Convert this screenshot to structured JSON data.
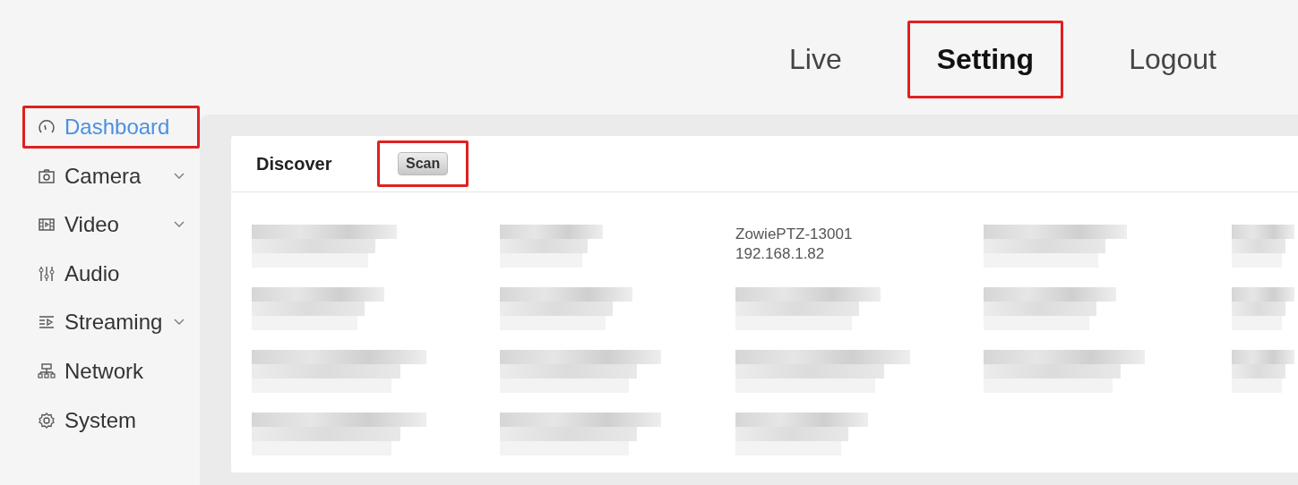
{
  "top_nav": [
    {
      "label": "Live",
      "selected": false,
      "annotated": false
    },
    {
      "label": "Setting",
      "selected": true,
      "annotated": true
    },
    {
      "label": "Logout",
      "selected": false,
      "annotated": false
    }
  ],
  "sidebar": {
    "items": [
      {
        "label": "Dashboard",
        "selected": true,
        "expandable": false,
        "annotated": true
      },
      {
        "label": "Camera",
        "selected": false,
        "expandable": true,
        "annotated": false
      },
      {
        "label": "Video",
        "selected": false,
        "expandable": true,
        "annotated": false
      },
      {
        "label": "Audio",
        "selected": false,
        "expandable": false,
        "annotated": false
      },
      {
        "label": "Streaming",
        "selected": false,
        "expandable": true,
        "annotated": false
      },
      {
        "label": "Network",
        "selected": false,
        "expandable": false,
        "annotated": false
      },
      {
        "label": "System",
        "selected": false,
        "expandable": false,
        "annotated": false
      }
    ]
  },
  "discover": {
    "title": "Discover",
    "scan_button": {
      "label": "Scan",
      "annotated": true
    },
    "devices": [
      {
        "kind": "blurred"
      },
      {
        "kind": "blurred"
      },
      {
        "kind": "device",
        "name": "ZowiePTZ-13001",
        "ip": "192.168.1.82"
      },
      {
        "kind": "blurred"
      },
      {
        "kind": "blurred"
      },
      {
        "kind": "blurred"
      },
      {
        "kind": "blurred"
      },
      {
        "kind": "blurred"
      },
      {
        "kind": "blurred"
      },
      {
        "kind": "blurred"
      },
      {
        "kind": "blurred"
      },
      {
        "kind": "blurred"
      },
      {
        "kind": "blurred"
      },
      {
        "kind": "blurred"
      },
      {
        "kind": "blurred"
      },
      {
        "kind": "blurred"
      },
      {
        "kind": "blurred"
      },
      {
        "kind": "blurred"
      }
    ]
  }
}
